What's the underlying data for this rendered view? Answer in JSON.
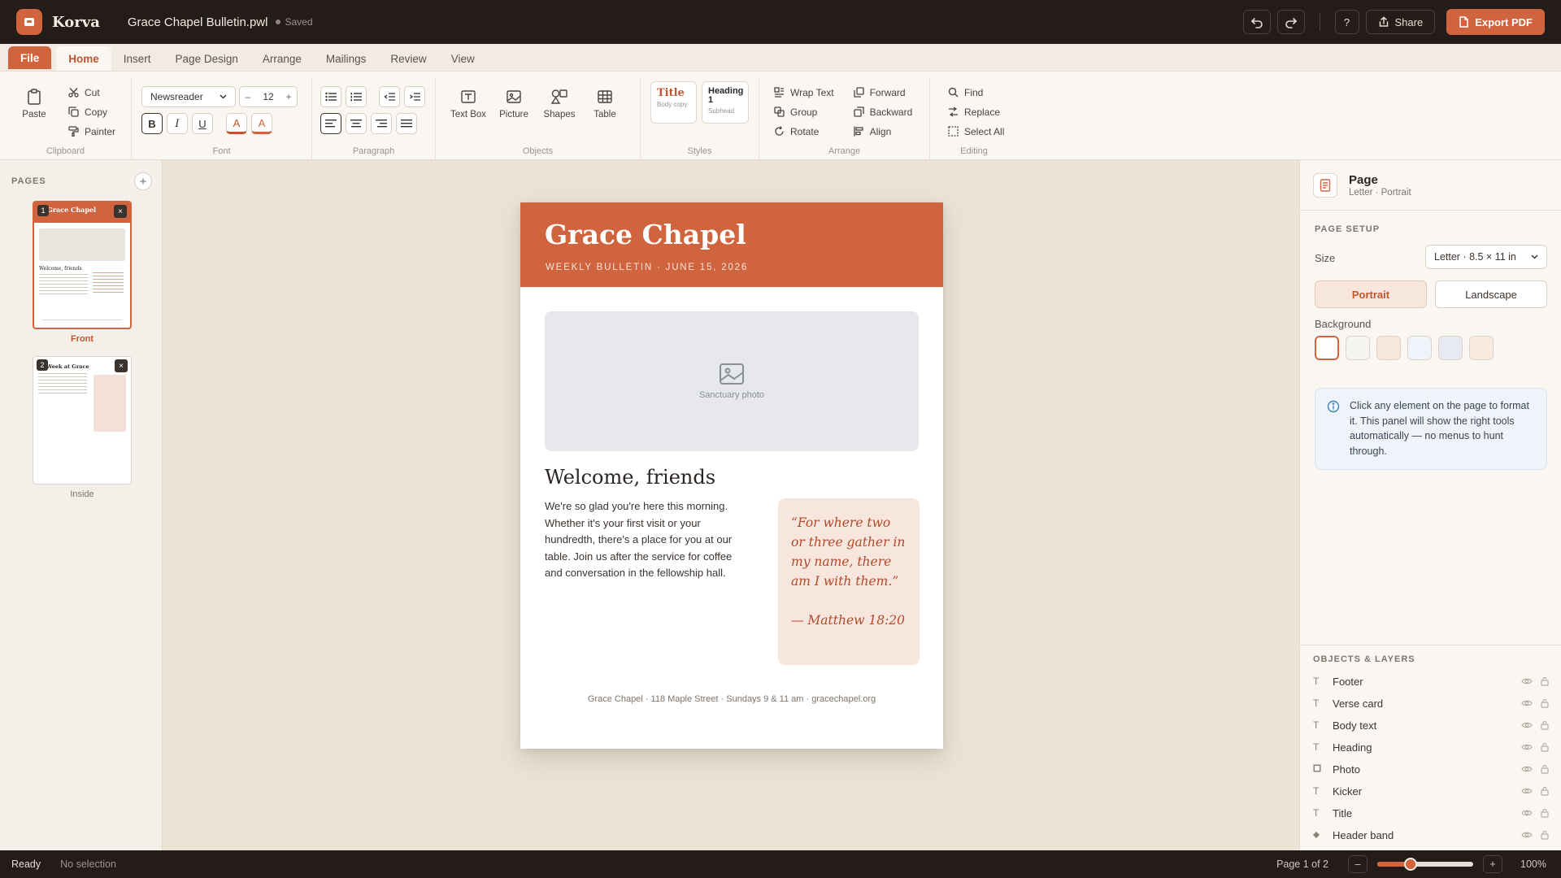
{
  "app": {
    "name": "Korva",
    "document": "Grace Chapel Bulletin.pwl",
    "save_status": "Saved"
  },
  "titlebar": {
    "help": "?",
    "share": "Share",
    "export": "Export PDF"
  },
  "tabs": [
    "File",
    "Home",
    "Insert",
    "Page Design",
    "Arrange",
    "Mailings",
    "Review",
    "View"
  ],
  "active_tab": "Home",
  "ribbon": {
    "clipboard": {
      "label": "Clipboard",
      "paste": "Paste",
      "cut": "Cut",
      "copy": "Copy",
      "painter": "Painter"
    },
    "font": {
      "label": "Font",
      "family": "Newsreader",
      "size": "12",
      "bold": "B",
      "italic": "I",
      "underline": "U",
      "color": "A",
      "highlight": "A"
    },
    "paragraph": {
      "label": "Paragraph"
    },
    "objects": {
      "label": "Objects",
      "text_box": "Text Box",
      "picture": "Picture",
      "shapes": "Shapes",
      "table": "Table"
    },
    "styles": {
      "label": "Styles",
      "title": "Title",
      "title_sub": "Body copy",
      "heading": "Heading 1",
      "heading_sub": "Subhead"
    },
    "arrange": {
      "label": "Arrange",
      "wrap_text": "Wrap Text",
      "group": "Group",
      "rotate": "Rotate",
      "forward": "Forward",
      "backward": "Backward",
      "align": "Align"
    },
    "editing": {
      "label": "Editing",
      "find": "Find",
      "replace": "Replace",
      "select_all": "Select All"
    }
  },
  "pages_panel": {
    "label": "PAGES",
    "add": "+",
    "pages": [
      {
        "num": "1",
        "caption": "Front",
        "selected": true,
        "title": "Grace Chapel",
        "heading": "Welcome, friends"
      },
      {
        "num": "2",
        "caption": "Inside",
        "selected": false,
        "title": "Week at Grace"
      }
    ]
  },
  "page": {
    "title": "Grace Chapel",
    "kicker": "WEEKLY BULLETIN  ·  JUNE 15, 2026",
    "photo_caption": "Sanctuary photo",
    "heading": "Welcome, friends",
    "body": "We're so glad you're here this morning. Whether it's your first visit or your hundredth, there's a place for you at our table. Join us after the service for coffee and conversation in the fellowship hall.",
    "verse": "“For where two or three gather in my name, there am I with them.”",
    "verse_ref": "— Matthew 18:20",
    "footer": "Grace Chapel  ·  118 Maple Street  ·  Sundays 9 & 11 am  ·  gracechapel.org"
  },
  "properties": {
    "title": "Page",
    "subtitle": "Letter · Portrait",
    "page_setup_label": "PAGE SETUP",
    "size_label": "Size",
    "size_value": "Letter · 8.5 × 11 in",
    "portrait": "Portrait",
    "landscape": "Landscape",
    "orientation": "Portrait",
    "background_label": "Background",
    "background_swatches": [
      "#ffffff",
      "#f7f5f2",
      "#f6e6dd",
      "#eef4fa",
      "#e6ebf1",
      "#f8ece2"
    ],
    "selected_background": "#ffffff",
    "info": "Click any element on the page to format it. This panel will show the right tools automatically — no menus to hunt through.",
    "layers_label": "OBJECTS & LAYERS",
    "layers": [
      {
        "name": "Footer",
        "type": "T"
      },
      {
        "name": "Verse card",
        "type": "T"
      },
      {
        "name": "Body text",
        "type": "T"
      },
      {
        "name": "Heading",
        "type": "T"
      },
      {
        "name": "Photo",
        "type": "img"
      },
      {
        "name": "Kicker",
        "type": "T"
      },
      {
        "name": "Title",
        "type": "T"
      },
      {
        "name": "Header band",
        "type": "shape"
      }
    ]
  },
  "status": {
    "ready": "Ready",
    "selection": "No selection",
    "page": "Page 1 of 2",
    "zoom": "100%",
    "zoom_level": 0.35
  },
  "colors": {
    "accent": "#d0643f",
    "titlebar": "#231c18",
    "canvas": "#ece3d6",
    "verse_bg": "#f6e6dd"
  }
}
